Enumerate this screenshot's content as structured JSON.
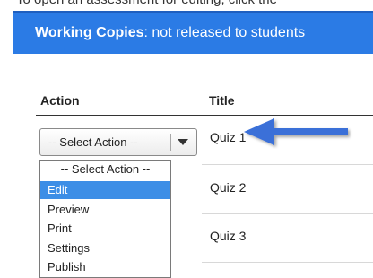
{
  "top_text": "To open an assessment for editing, click the",
  "banner": {
    "bold_label": "Working Copies",
    "rest_label": ": not released to students",
    "color": "#2b7be5"
  },
  "table": {
    "columns": [
      "Action",
      "Title"
    ],
    "rows": [
      {
        "title": "Quiz 1"
      },
      {
        "title": "Quiz 2"
      },
      {
        "title": "Quiz 3"
      }
    ]
  },
  "select": {
    "value": "-- Select Action --",
    "options": [
      "-- Select Action --",
      "Edit",
      "Preview",
      "Print",
      "Settings",
      "Publish"
    ],
    "highlighted": "Edit",
    "highlight_color": "#3d8ee6"
  },
  "annotation": {
    "icon": "left-arrow-icon",
    "color": "#3a6fd8"
  }
}
